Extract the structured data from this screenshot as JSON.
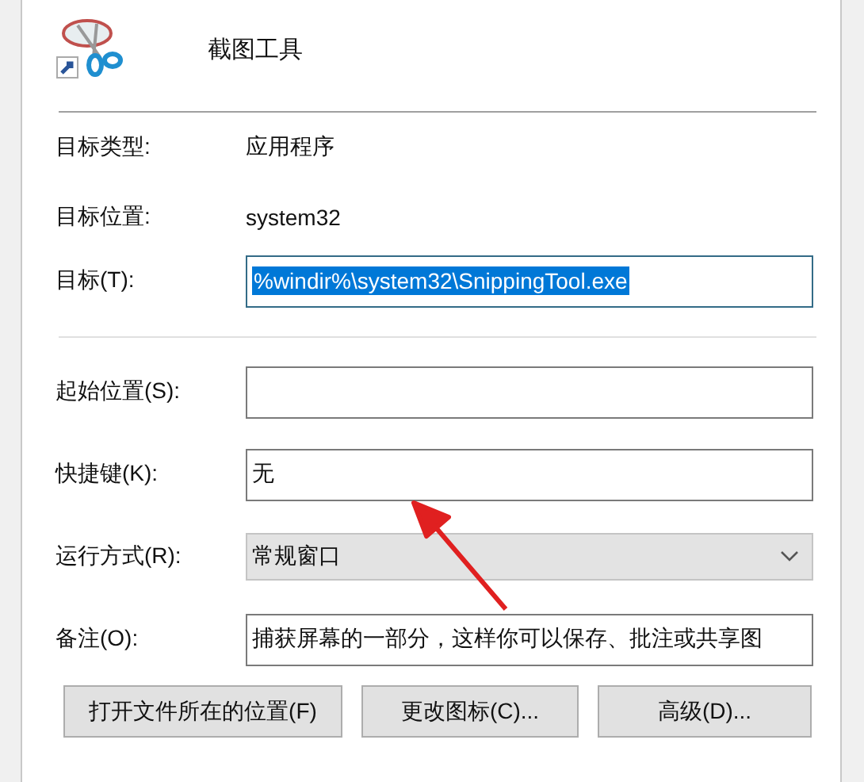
{
  "header": {
    "title": "截图工具"
  },
  "info_rows": [
    {
      "label": "目标类型:",
      "value": "应用程序"
    },
    {
      "label": "目标位置:",
      "value": "system32"
    }
  ],
  "target": {
    "label": "目标(T):",
    "value": "%windir%\\system32\\SnippingTool.exe",
    "selected": true
  },
  "fields": [
    {
      "kind": "text",
      "label": "起始位置(S):"
    },
    {
      "kind": "text",
      "label": "快捷键(K):",
      "value": "无"
    },
    {
      "kind": "dropdown",
      "label": "运行方式(R):",
      "value": "常规窗口"
    },
    {
      "kind": "text",
      "label": "备注(O):",
      "value": "捕获屏幕的一部分，这样你可以保存、批注或共享图"
    }
  ],
  "buttons": [
    "打开文件所在的位置(F)",
    "更改图标(C)...",
    "高级(D)..."
  ]
}
